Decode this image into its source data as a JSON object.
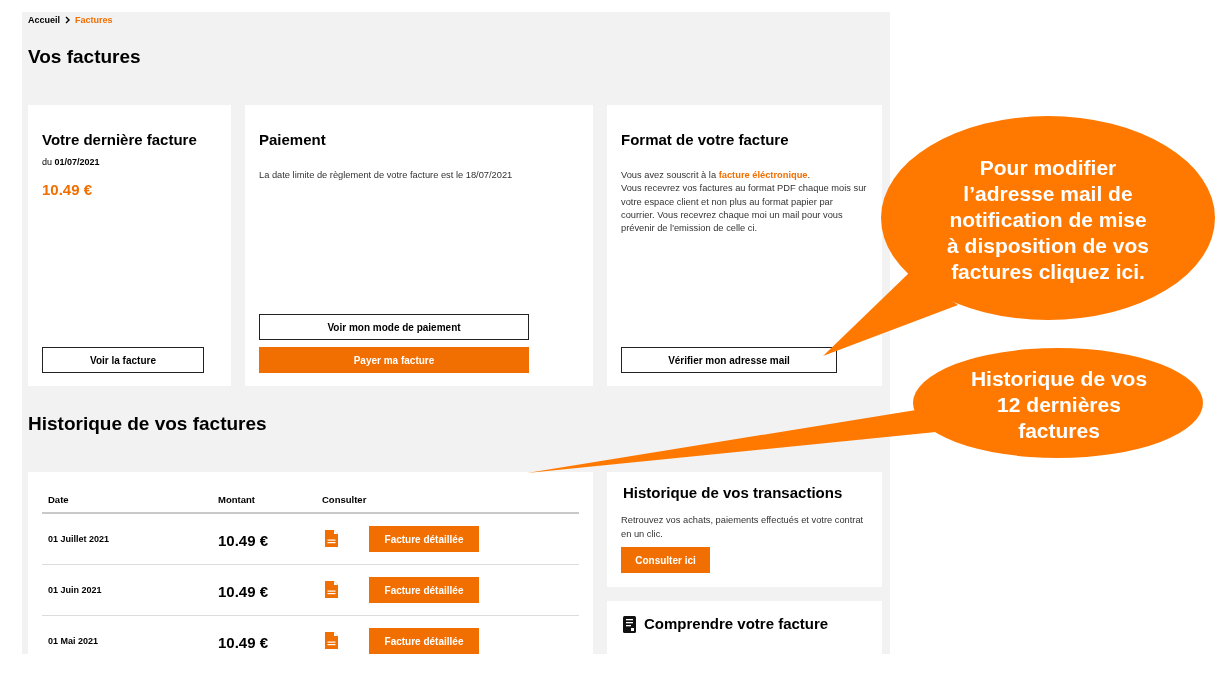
{
  "breadcrumb": [
    {
      "label": "Accueil",
      "current": false
    },
    {
      "label": "Factures",
      "current": true
    }
  ],
  "page_title": "Vos factures",
  "cards": [
    {
      "kind": "invoice",
      "title": "Votre dernière facture",
      "date": "du **01/07/2021**",
      "amount": "10.49 €",
      "buttons": [
        {
          "label": "Voir la facture",
          "kind": "secondary"
        }
      ]
    },
    {
      "kind": "text",
      "title": "Paiement",
      "paragraphs": [
        [
          "La date limite de règlement de votre facture est le 18/07/2021"
        ]
      ],
      "buttons": [
        {
          "label": "Voir mon mode de paiement",
          "kind": "secondary"
        },
        {
          "label": "Payer ma facture",
          "kind": "primary"
        }
      ]
    },
    {
      "kind": "text",
      "title": "Format de votre facture",
      "paragraphs": [
        [
          "Vous avez souscrit à la **facture éléctronique**."
        ],
        [
          "Vous recevrez vos factures au format PDF chaque mois sur",
          "votre espace client et non plus au format papier par",
          "courrier. Vous recevrez chaque moi un mail pour vous",
          "prévenir de l'emission de celle ci."
        ]
      ],
      "buttons": [
        {
          "label": "Vérifier mon adresse mail",
          "kind": "secondary"
        }
      ]
    }
  ],
  "history": {
    "title": "Historique de vos factures",
    "columns": [
      "Date",
      "Montant",
      "Consulter"
    ],
    "rows": [
      {
        "date": "01 Juillet 2021",
        "amount": "10.49 €",
        "action": "Facture détaillée"
      },
      {
        "date": "01 Juin 2021",
        "amount": "10.49 €",
        "action": "Facture détaillée"
      },
      {
        "date": "01 Mai 2021",
        "amount": "10.49 €",
        "action": "Facture détaillée"
      }
    ]
  },
  "transactions": {
    "title": "Historique de vos transactions",
    "text": "Retrouvez vos achats, paiements effectués et votre contrat en un clic.",
    "button": "Consulter ici"
  },
  "help": {
    "title": "Comprendre votre facture"
  },
  "callouts": [
    {
      "lines": [
        "Pour modifier",
        "l’adresse mail de",
        "notification de mise",
        "à disposition de vos",
        "factures cliquez ici."
      ]
    },
    {
      "lines": [
        "Historique de vos",
        "12 dernières",
        "factures"
      ]
    }
  ]
}
